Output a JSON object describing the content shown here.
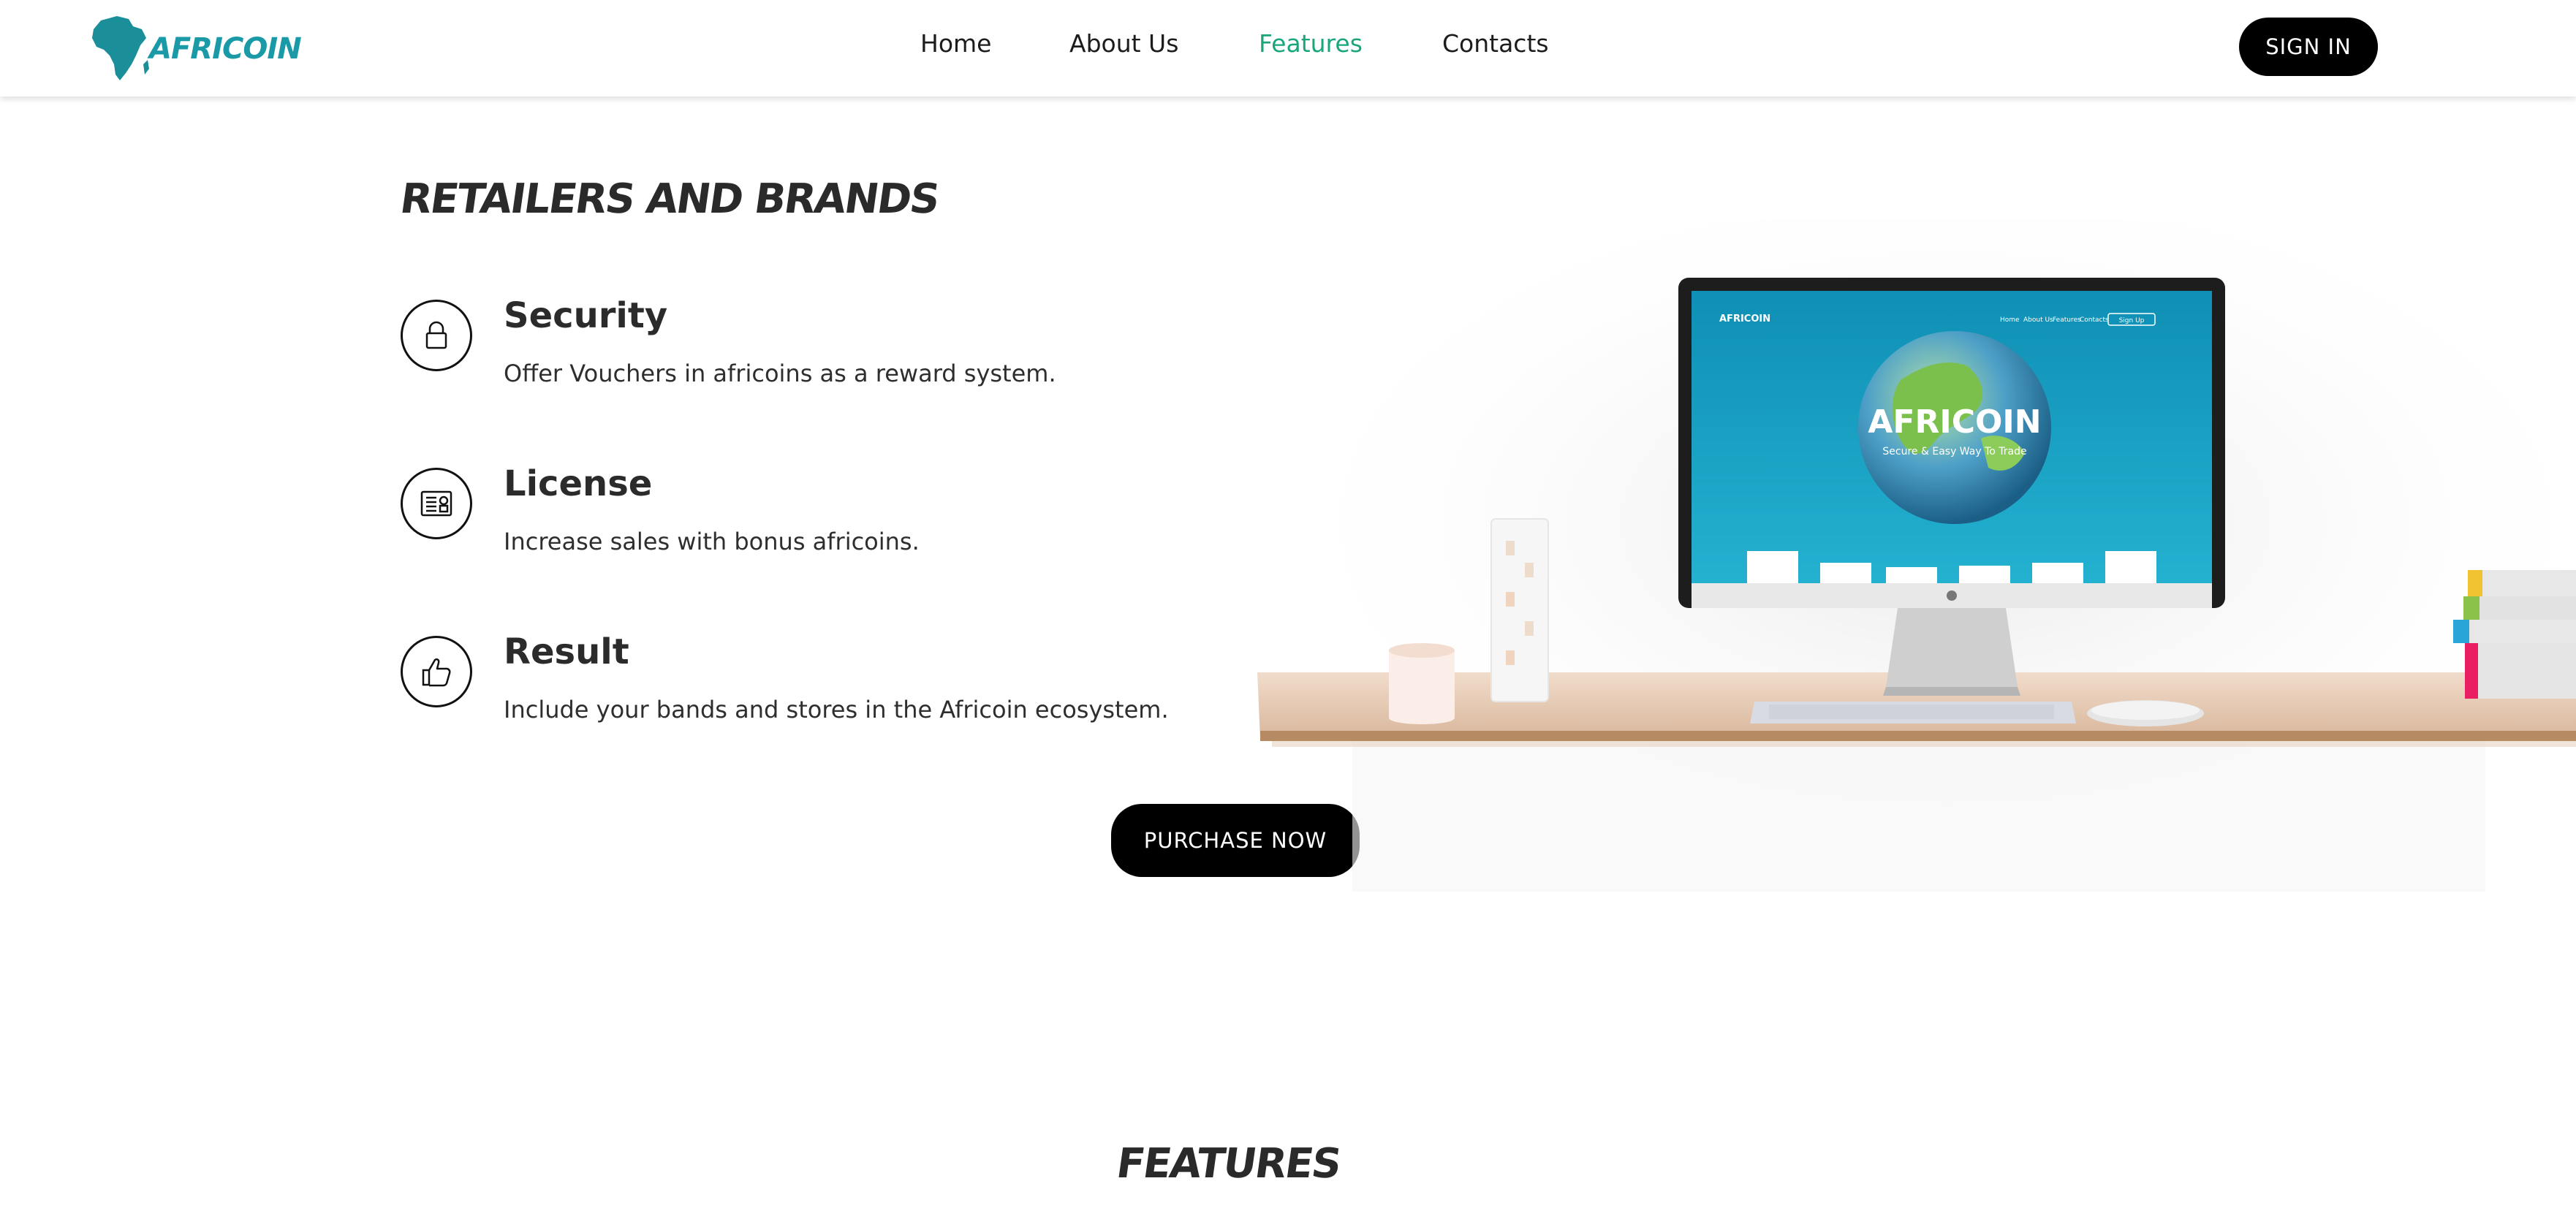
{
  "header": {
    "logo_text": "AFRICOIN",
    "nav": [
      "Home",
      "About Us",
      "Features",
      "Contacts"
    ],
    "active_nav": "Features",
    "signin_label": "SIGN IN"
  },
  "section": {
    "title": "RETAILERS AND BRANDS",
    "features": [
      {
        "icon": "lock-icon",
        "title": "Security",
        "desc": "Offer Vouchers in africoins as a reward system."
      },
      {
        "icon": "license-icon",
        "title": "License",
        "desc": "Increase sales with bonus africoins."
      },
      {
        "icon": "thumbs-up-icon",
        "title": "Result",
        "desc": "Include your bands and stores in the Africoin ecosystem."
      }
    ],
    "purchase_label": "PURCHASE NOW"
  },
  "illustration": {
    "screen_logo": "AFRICOIN",
    "screen_tagline": "Secure & Easy Way To Trade",
    "screen_nav": [
      "Home",
      "About Us",
      "Features",
      "Contacts",
      "Sign Up"
    ]
  },
  "features_section": {
    "title": "FEATURES"
  },
  "colors": {
    "accent": "#1aa67c",
    "brand_teal": "#1a9aa7",
    "button": "#000000"
  }
}
